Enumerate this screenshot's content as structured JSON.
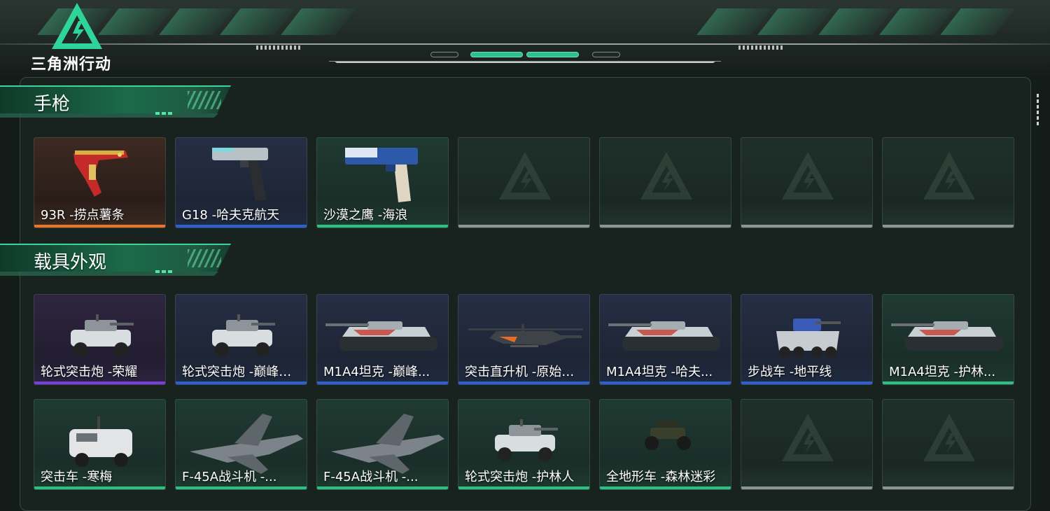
{
  "game": {
    "logo_text": "三角洲行动",
    "logo_icon": "delta-triangle-logo"
  },
  "sections": [
    {
      "title": "手枪",
      "items": [
        {
          "name": "93R -捞点薯条",
          "rarity": "orange",
          "icon": "pistol-93r-icon"
        },
        {
          "name": "G18 -哈夫克航天",
          "rarity": "blue",
          "icon": "pistol-g18-icon"
        },
        {
          "name": "沙漠之鹰 -海浪",
          "rarity": "green",
          "icon": "pistol-deagle-icon"
        },
        {
          "name": "",
          "rarity": "empty",
          "icon": "empty-slot-icon"
        },
        {
          "name": "",
          "rarity": "empty",
          "icon": "empty-slot-icon"
        },
        {
          "name": "",
          "rarity": "empty",
          "icon": "empty-slot-icon"
        },
        {
          "name": "",
          "rarity": "empty",
          "icon": "empty-slot-icon"
        }
      ]
    },
    {
      "title": "载具外观",
      "items": [
        {
          "name": "轮式突击炮 -荣耀",
          "rarity": "purple",
          "icon": "wheeled-assault-gun-icon"
        },
        {
          "name": "轮式突击炮 -巅峰竞...",
          "rarity": "blue",
          "icon": "wheeled-assault-gun-icon"
        },
        {
          "name": "M1A4坦克 -巅峰...",
          "rarity": "blue",
          "icon": "tank-icon"
        },
        {
          "name": "突击直升机 -原始伪...",
          "rarity": "blue",
          "icon": "helicopter-icon"
        },
        {
          "name": "M1A4坦克 -哈夫...",
          "rarity": "blue",
          "icon": "tank-icon"
        },
        {
          "name": "步战车 -地平线",
          "rarity": "blue",
          "icon": "ifv-icon"
        },
        {
          "name": "M1A4坦克 -护林...",
          "rarity": "green",
          "icon": "tank-icon"
        },
        {
          "name": "突击车 -寒梅",
          "rarity": "green",
          "icon": "assault-vehicle-icon"
        },
        {
          "name": "F-45A战斗机 -...",
          "rarity": "green",
          "icon": "fighter-jet-icon"
        },
        {
          "name": "F-45A战斗机 -...",
          "rarity": "green",
          "icon": "fighter-jet-icon"
        },
        {
          "name": "轮式突击炮 -护林人",
          "rarity": "green",
          "icon": "wheeled-assault-gun-icon"
        },
        {
          "name": "全地形车 -森林迷彩",
          "rarity": "green",
          "icon": "atv-icon"
        },
        {
          "name": "",
          "rarity": "empty",
          "icon": "empty-slot-icon"
        },
        {
          "name": "",
          "rarity": "empty",
          "icon": "empty-slot-icon"
        }
      ]
    }
  ],
  "colors": {
    "accent": "#2cc083",
    "orange": "#e9742b",
    "blue": "#2f5fd0",
    "green": "#2cc083",
    "purple": "#7a3fd6",
    "empty": "#8f9592"
  }
}
